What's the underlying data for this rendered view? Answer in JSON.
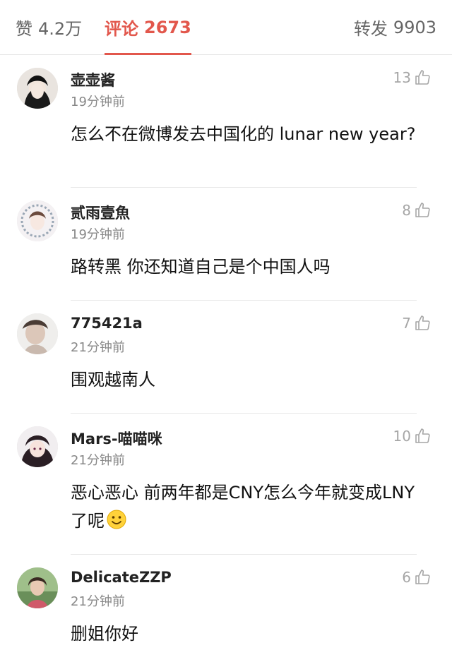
{
  "tabs": {
    "likes": {
      "label": "赞",
      "count": "4.2万"
    },
    "comments": {
      "label": "评论",
      "count": "2673"
    },
    "reposts": {
      "label": "转发",
      "count": "9903"
    }
  },
  "comments": [
    {
      "user": "壶壶酱",
      "time": "19分钟前",
      "likes": "13",
      "text": "怎么不在微博发去中国化的 lunar new year?"
    },
    {
      "user": "贰雨壹魚",
      "time": "19分钟前",
      "likes": "8",
      "text": "路转黑 你还知道自己是个中国人吗"
    },
    {
      "user": "775421a",
      "time": "21分钟前",
      "likes": "7",
      "text": "围观越南人"
    },
    {
      "user": "Mars-喵喵咪",
      "time": "21分钟前",
      "likes": "10",
      "text": "恶心恶心 前两年都是CNY怎么今年就变成LNY了呢"
    },
    {
      "user": "DelicateZZP",
      "time": "21分钟前",
      "likes": "6",
      "text": "删姐你好"
    }
  ],
  "colors": {
    "accent": "#e2574c",
    "muted": "#888888"
  }
}
